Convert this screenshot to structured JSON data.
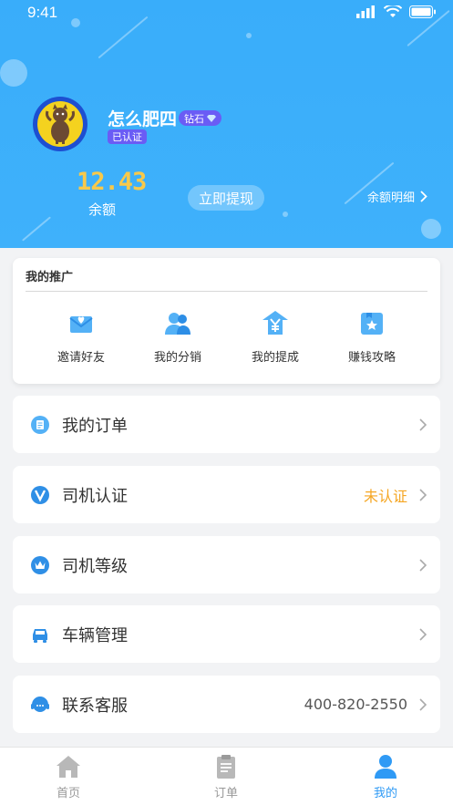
{
  "status_bar": {
    "time": "9:41"
  },
  "profile": {
    "username": "怎么肥四",
    "vip_level": "钻石",
    "cert_status": "已认证",
    "balance": "12.43",
    "balance_label": "余额",
    "withdraw_label": "立即提现",
    "balance_detail_label": "余额明细"
  },
  "promotion": {
    "title": "我的推广",
    "items": [
      {
        "label": "邀请好友",
        "icon": "invite-envelope-icon"
      },
      {
        "label": "我的分销",
        "icon": "users-icon"
      },
      {
        "label": "我的提成",
        "icon": "yen-commission-icon"
      },
      {
        "label": "赚钱攻略",
        "icon": "star-guide-icon"
      }
    ]
  },
  "menu": [
    {
      "label": "我的订单",
      "value": "",
      "icon": "order-icon"
    },
    {
      "label": "司机认证",
      "value": "未认证",
      "icon": "verify-v-icon"
    },
    {
      "label": "司机等级",
      "value": "",
      "icon": "crown-level-icon"
    },
    {
      "label": "车辆管理",
      "value": "",
      "icon": "car-icon"
    },
    {
      "label": "联系客服",
      "value": "400-820-2550",
      "icon": "headset-icon"
    }
  ],
  "tabbar": [
    {
      "label": "首页",
      "icon": "home-icon",
      "active": false
    },
    {
      "label": "订单",
      "icon": "clipboard-icon",
      "active": false
    },
    {
      "label": "我的",
      "icon": "person-icon",
      "active": true
    }
  ],
  "colors": {
    "header_blue": "#39adfa",
    "accent_blue": "#2f9af5",
    "badge_purple": "#6a5cf5",
    "balance_yellow": "#f8c94a",
    "warn_orange": "#f5a623"
  }
}
